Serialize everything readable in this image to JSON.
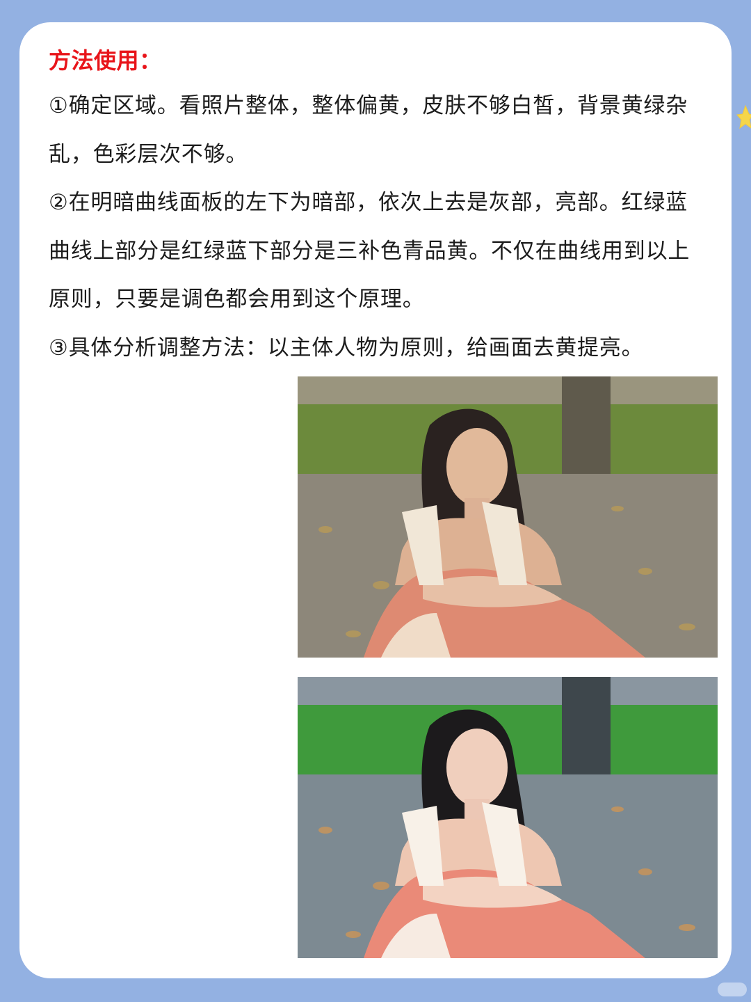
{
  "heading": "方法使用：",
  "paragraphs": [
    "①确定区域。看照片整体，整体偏黄，皮肤不够白皙，背景黄绿杂乱，色彩层次不够。",
    "②在明暗曲线面板的左下为暗部，依次上去是灰部，亮部。红绿蓝曲线上部分是红绿蓝下部分是三补色青品黄。不仅在曲线用到以上原则，只要是调色都会用到这个原理。",
    "③具体分析调整方法：以主体人物为原则，给画面去黄提亮。"
  ],
  "colors": {
    "page_background": "#93b1e2",
    "card_background": "#ffffff",
    "heading": "#e8141a",
    "text": "#1c1c1c"
  },
  "icons": {
    "corner": "star-icon"
  }
}
